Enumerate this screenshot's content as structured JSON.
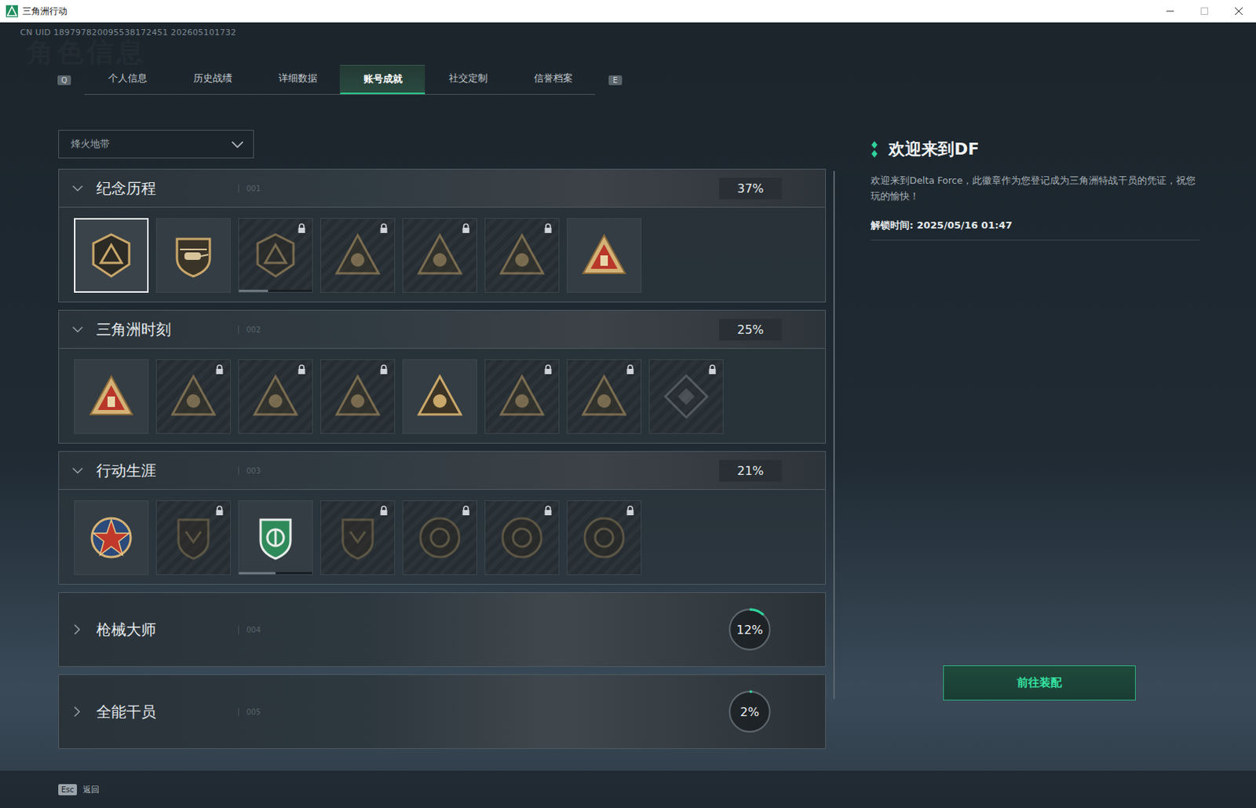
{
  "window": {
    "title": "三角洲行动"
  },
  "uid": "CN UID 189797820095538172451 202605101732",
  "watermark": "角色信息",
  "tab_keys": {
    "prev": "Q",
    "next": "E"
  },
  "tabs": [
    {
      "label": "个人信息",
      "selected": false
    },
    {
      "label": "历史战绩",
      "selected": false
    },
    {
      "label": "详细数据",
      "selected": false
    },
    {
      "label": "账号成就",
      "selected": true
    },
    {
      "label": "社交定制",
      "selected": false
    },
    {
      "label": "信誉档案",
      "selected": false
    }
  ],
  "mode_dropdown": {
    "value": "烽火地带"
  },
  "sections": [
    {
      "title": "纪念历程",
      "code": "001",
      "percent": "37%",
      "expanded": true,
      "badges": [
        {
          "kind": "hex",
          "locked": false,
          "selected": true
        },
        {
          "kind": "heli",
          "locked": false,
          "selected": false
        },
        {
          "kind": "hex",
          "locked": true,
          "selected": false,
          "level": 0.4
        },
        {
          "kind": "triangle",
          "locked": true,
          "selected": false
        },
        {
          "kind": "triangle",
          "locked": true,
          "selected": false
        },
        {
          "kind": "triangle",
          "locked": true,
          "selected": false
        },
        {
          "kind": "red-triangle",
          "locked": false,
          "selected": false
        }
      ]
    },
    {
      "title": "三角洲时刻",
      "code": "002",
      "percent": "25%",
      "expanded": true,
      "badges": [
        {
          "kind": "red-triangle",
          "locked": false,
          "selected": false
        },
        {
          "kind": "triangle",
          "locked": true,
          "selected": false
        },
        {
          "kind": "triangle",
          "locked": true,
          "selected": false
        },
        {
          "kind": "triangle",
          "locked": true,
          "selected": false
        },
        {
          "kind": "triangle",
          "locked": false,
          "selected": false
        },
        {
          "kind": "triangle",
          "locked": true,
          "selected": false
        },
        {
          "kind": "triangle",
          "locked": true,
          "selected": false
        },
        {
          "kind": "diamond",
          "locked": true,
          "selected": false
        }
      ]
    },
    {
      "title": "行动生涯",
      "code": "003",
      "percent": "21%",
      "expanded": true,
      "badges": [
        {
          "kind": "star",
          "locked": false,
          "selected": false
        },
        {
          "kind": "shield",
          "locked": true,
          "selected": false
        },
        {
          "kind": "green-shield",
          "locked": false,
          "selected": false,
          "level": 0.5
        },
        {
          "kind": "shield",
          "locked": true,
          "selected": false
        },
        {
          "kind": "round",
          "locked": true,
          "selected": false
        },
        {
          "kind": "round",
          "locked": true,
          "selected": false
        },
        {
          "kind": "round",
          "locked": true,
          "selected": false
        }
      ]
    },
    {
      "title": "枪械大师",
      "code": "004",
      "percent": "12%",
      "expanded": false,
      "level": 0.12,
      "badges": []
    },
    {
      "title": "全能干员",
      "code": "005",
      "percent": "2%",
      "expanded": false,
      "level": 0.02,
      "badges": []
    }
  ],
  "detail": {
    "title": "欢迎来到DF",
    "description": "欢迎来到Delta Force，此徽章作为您登记成为三角洲特战干员的凭证，祝您玩的愉快！",
    "unlock": "解锁时间: 2025/05/16 01:47",
    "button": "前往装配"
  },
  "footer": {
    "key": "Esc",
    "label": "返回"
  }
}
